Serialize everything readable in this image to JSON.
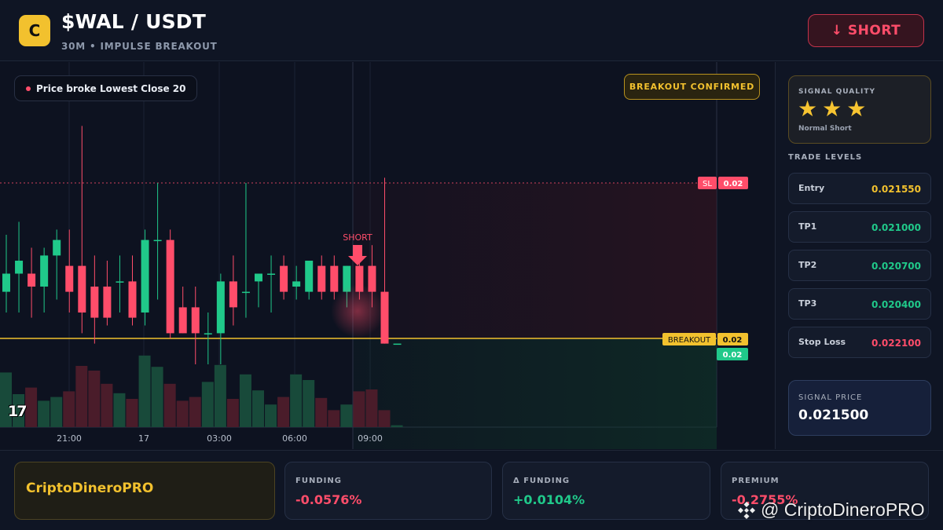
{
  "header": {
    "logo_letter": "C",
    "pair": "$WAL / USDT",
    "subtitle": "30M • IMPULSE BREAKOUT",
    "short_button": "↓ SHORT"
  },
  "chart": {
    "note_pill": "Price broke Lowest Close 20",
    "confirmed_badge": "BREAKOUT CONFIRMED",
    "short_marker_label": "SHORT",
    "sl_tag": "SL",
    "sl_value": "0.02",
    "breakout_tag": "BREAKOUT",
    "breakout_value": "0.02",
    "price_tag_value": "0.02",
    "tv_logo": "17",
    "time_labels": [
      "21:00",
      "17",
      "03:00",
      "06:00",
      "09:00"
    ]
  },
  "chart_data": {
    "type": "candlestick",
    "levels": {
      "stop_loss": 0.0221,
      "breakout": 0.0215,
      "entry": 0.02155
    },
    "candles": [
      {
        "o": 0.02168,
        "h": 0.0219,
        "l": 0.0216,
        "c": 0.02175
      },
      {
        "o": 0.02175,
        "h": 0.02195,
        "l": 0.0216,
        "c": 0.0218
      },
      {
        "o": 0.02175,
        "h": 0.02185,
        "l": 0.02158,
        "c": 0.0217
      },
      {
        "o": 0.0217,
        "h": 0.02185,
        "l": 0.0216,
        "c": 0.02182
      },
      {
        "o": 0.02182,
        "h": 0.02192,
        "l": 0.02165,
        "c": 0.02188
      },
      {
        "o": 0.02178,
        "h": 0.02192,
        "l": 0.0216,
        "c": 0.02168
      },
      {
        "o": 0.02178,
        "h": 0.02232,
        "l": 0.02152,
        "c": 0.0216
      },
      {
        "o": 0.0217,
        "h": 0.02182,
        "l": 0.02148,
        "c": 0.02158
      },
      {
        "o": 0.0217,
        "h": 0.0218,
        "l": 0.02155,
        "c": 0.02158
      },
      {
        "o": 0.02172,
        "h": 0.02182,
        "l": 0.0216,
        "c": 0.02172
      },
      {
        "o": 0.02172,
        "h": 0.02182,
        "l": 0.02155,
        "c": 0.02158
      },
      {
        "o": 0.0216,
        "h": 0.02192,
        "l": 0.02155,
        "c": 0.02188
      },
      {
        "o": 0.02188,
        "h": 0.0221,
        "l": 0.02165,
        "c": 0.02188
      },
      {
        "o": 0.02188,
        "h": 0.02192,
        "l": 0.0215,
        "c": 0.02152
      },
      {
        "o": 0.02162,
        "h": 0.0217,
        "l": 0.02152,
        "c": 0.02152
      },
      {
        "o": 0.02162,
        "h": 0.0217,
        "l": 0.0214,
        "c": 0.02152
      },
      {
        "o": 0.02152,
        "h": 0.0216,
        "l": 0.0214,
        "c": 0.02152
      },
      {
        "o": 0.02152,
        "h": 0.02175,
        "l": 0.0214,
        "c": 0.02172
      },
      {
        "o": 0.02172,
        "h": 0.02182,
        "l": 0.02155,
        "c": 0.02162
      },
      {
        "o": 0.02168,
        "h": 0.0221,
        "l": 0.02158,
        "c": 0.02168
      },
      {
        "o": 0.02172,
        "h": 0.02175,
        "l": 0.02162,
        "c": 0.02175
      },
      {
        "o": 0.02175,
        "h": 0.02182,
        "l": 0.0216,
        "c": 0.02175
      },
      {
        "o": 0.02178,
        "h": 0.02182,
        "l": 0.02165,
        "c": 0.02168
      },
      {
        "o": 0.0217,
        "h": 0.02178,
        "l": 0.02165,
        "c": 0.02172
      },
      {
        "o": 0.02168,
        "h": 0.02178,
        "l": 0.02165,
        "c": 0.0218
      },
      {
        "o": 0.02178,
        "h": 0.02182,
        "l": 0.02165,
        "c": 0.02168
      },
      {
        "o": 0.02178,
        "h": 0.02182,
        "l": 0.02165,
        "c": 0.02168
      },
      {
        "o": 0.02168,
        "h": 0.02178,
        "l": 0.02162,
        "c": 0.02178
      },
      {
        "o": 0.02178,
        "h": 0.02182,
        "l": 0.02165,
        "c": 0.02168
      },
      {
        "o": 0.02178,
        "h": 0.02186,
        "l": 0.02162,
        "c": 0.02168
      },
      {
        "o": 0.02168,
        "h": 0.02212,
        "l": 0.02148,
        "c": 0.02148
      },
      {
        "o": 0.02148,
        "h": 0.02148,
        "l": 0.02148,
        "c": 0.02148
      }
    ],
    "volumes": [
      0.58,
      0.35,
      0.42,
      0.28,
      0.32,
      0.38,
      0.65,
      0.6,
      0.46,
      0.36,
      0.3,
      0.76,
      0.64,
      0.46,
      0.28,
      0.32,
      0.48,
      0.66,
      0.3,
      0.56,
      0.39,
      0.24,
      0.32,
      0.56,
      0.5,
      0.31,
      0.18,
      0.24,
      0.38,
      0.4,
      0.18,
      0.02
    ],
    "x_ticks": [
      "21:00",
      "17",
      "03:00",
      "06:00",
      "09:00"
    ]
  },
  "side": {
    "quality_label": "SIGNAL QUALITY",
    "stars": "★★★",
    "quality_note": "Normal Short",
    "levels_title": "TRADE LEVELS",
    "levels": [
      {
        "label": "Entry",
        "value": "0.021550",
        "color": "#f2c12e"
      },
      {
        "label": "TP1",
        "value": "0.021000",
        "color": "#20c98a"
      },
      {
        "label": "TP2",
        "value": "0.020700",
        "color": "#20c98a"
      },
      {
        "label": "TP3",
        "value": "0.020400",
        "color": "#20c98a"
      },
      {
        "label": "Stop Loss",
        "value": "0.022100",
        "color": "#ff4d6a"
      }
    ],
    "signal_price_label": "SIGNAL PRICE",
    "signal_price": "0.021500"
  },
  "footer": {
    "brand": "CriptoDineroPRO",
    "stats": [
      {
        "label": "FUNDING",
        "value": "-0.0576%",
        "color": "#ff4d6a"
      },
      {
        "label": "Δ FUNDING",
        "value": "+0.0104%",
        "color": "#20c98a"
      },
      {
        "label": "PREMIUM",
        "value": "-0.2755%",
        "color": "#ff4d6a"
      }
    ]
  },
  "watermark": "@ CriptoDineroPRO",
  "colors": {
    "up": "#20c98a",
    "down": "#ff4d6a",
    "accent": "#f2c12e"
  }
}
